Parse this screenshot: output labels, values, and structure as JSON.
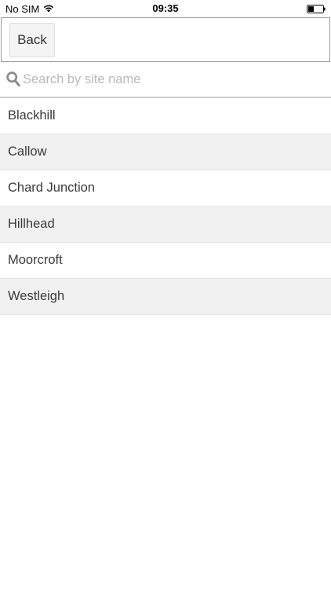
{
  "status_bar": {
    "carrier": "No SIM",
    "time": "09:35",
    "icons": [
      "wifi-icon",
      "battery-icon"
    ]
  },
  "header": {
    "back_label": "Back"
  },
  "search": {
    "placeholder": "Search by site name",
    "value": "",
    "icon": "search-icon"
  },
  "sites": [
    "Blackhill",
    "Callow",
    "Chard Junction",
    "Hillhead",
    "Moorcroft",
    "Westleigh"
  ],
  "colors": {
    "row_alt": "#f1f1f1",
    "row": "#ffffff",
    "placeholder": "#b9b9b9",
    "header_border": "#9c9c9c"
  }
}
